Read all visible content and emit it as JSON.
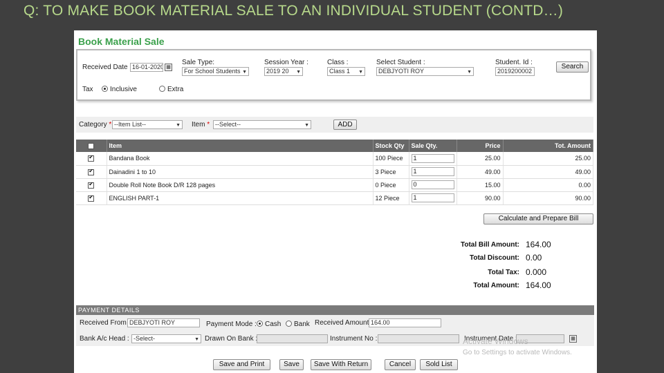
{
  "slide": {
    "title": "Q: TO MAKE BOOK MATERIAL SALE TO AN INDIVIDUAL STUDENT (CONTD…)"
  },
  "form": {
    "heading": "Book Material Sale",
    "received_date_label": "Received Date :",
    "received_date_value": "16-01-2020",
    "sale_type_label": "Sale Type:",
    "sale_type_value": "For School Students",
    "session_year_label": "Session Year :",
    "session_year_value": "2019 20",
    "class_label": "Class :",
    "class_value": "Class 1",
    "select_student_label": "Select Student :",
    "select_student_value": "DEBJYOTI ROY",
    "student_id_label": "Student. Id :",
    "student_id_value": "2019200002",
    "search_label": "Search",
    "tax_label": "Tax",
    "tax_inclusive": "Inclusive",
    "tax_extra": "Extra"
  },
  "category_bar": {
    "category_label": "Category",
    "required_mark": "*",
    "category_value": "--Item List--",
    "item_label": "Item",
    "item_value": "--Select--",
    "add_label": "ADD"
  },
  "table": {
    "headers": [
      "Item",
      "Stock Qty",
      "Sale Qty.",
      "Price",
      "Tot. Amount"
    ],
    "rows": [
      {
        "item": "Bandana Book",
        "stock": "100 Piece",
        "qty": "1",
        "price": "25.00",
        "total": "25.00"
      },
      {
        "item": "Dainadini 1 to 10",
        "stock": "3 Piece",
        "qty": "1",
        "price": "49.00",
        "total": "49.00"
      },
      {
        "item": "Double Roll Note Book D/R 128 pages",
        "stock": "0 Piece",
        "qty": "0",
        "price": "15.00",
        "total": "0.00"
      },
      {
        "item": "ENGLISH PART-1",
        "stock": "12 Piece",
        "qty": "1",
        "price": "90.00",
        "total": "90.00"
      }
    ]
  },
  "calc_button_label": "Calculate and Prepare Bill",
  "totals": {
    "bill_label": "Total Bill Amount:",
    "bill_value": "164.00",
    "discount_label": "Total Discount:",
    "discount_value": "0.00",
    "tax_label": "Total Tax:",
    "tax_value": "0.000",
    "amount_label": "Total Amount:",
    "amount_value": "164.00"
  },
  "payment": {
    "header": "PAYMENT DETAILS",
    "received_from_label": "Received From :",
    "received_from_value": "DEBJYOTI ROY",
    "payment_mode_label": "Payment Mode :",
    "mode_cash": "Cash",
    "mode_bank": "Bank",
    "received_amount_label": "Received Amount :",
    "received_amount_value": "164.00",
    "bank_ac_head_label": "Bank A/c Head :",
    "bank_ac_head_value": "-Select-",
    "drawn_on_bank_label": "Drawn On Bank :",
    "instrument_no_label": "Instrument No :",
    "instrument_date_label": "Instrument Date :"
  },
  "buttons": {
    "save_print": "Save and Print",
    "save": "Save",
    "save_return": "Save With Return",
    "cancel": "Cancel",
    "sold_list": "Sold List"
  },
  "watermark": {
    "line1": "Activate Windows",
    "line2": "Go to Settings to activate Windows."
  },
  "colors": {
    "slide_bg": "#3f3f3f",
    "title": "#b7d98b",
    "heading": "#3aa04b",
    "table_header": "#676767"
  }
}
